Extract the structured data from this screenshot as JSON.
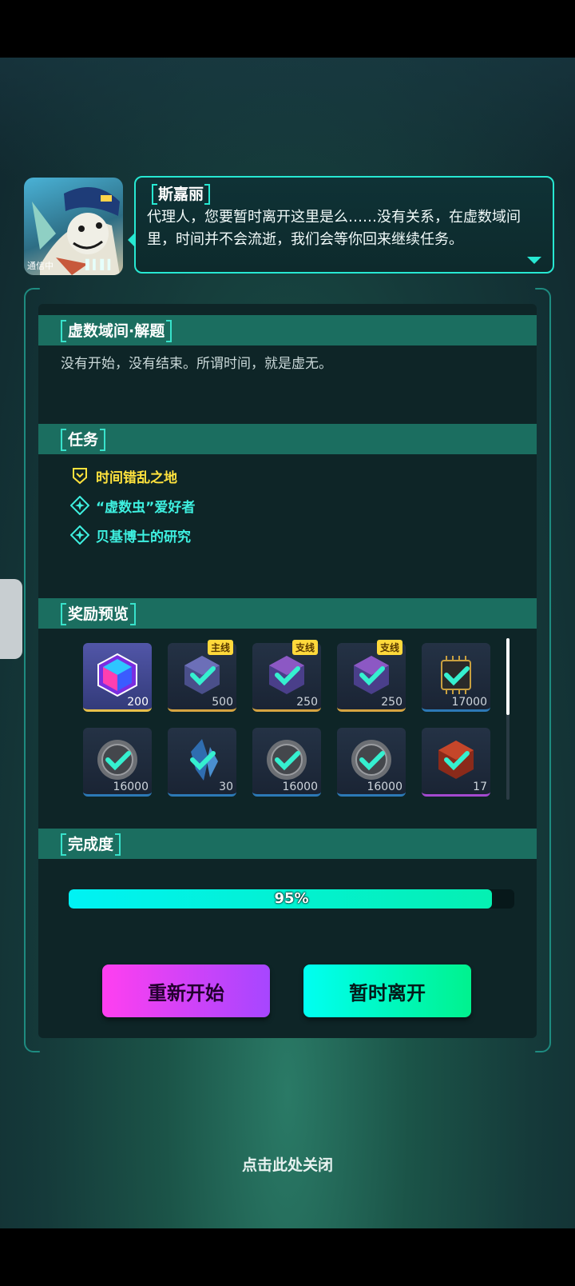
{
  "dialogue": {
    "speaker": "斯嘉丽",
    "text": "代理人，您要暂时离开这里是么……没有关系，在虚数域间里，时间并不会流逝，我们会等你回来继续任务。",
    "portrait_tag": "通信中"
  },
  "sections": {
    "info_title": "虚数域间·解题",
    "info_desc": "没有开始，没有结束。所谓时间，就是虚无。",
    "tasks_title": "任务",
    "rewards_title": "奖励预览",
    "completion_title": "完成度"
  },
  "tasks": [
    {
      "label": "时间错乱之地",
      "type": "main",
      "icon": "shield-quest-icon"
    },
    {
      "label": "“虚数虫”爱好者",
      "type": "side",
      "icon": "diamond-quest-icon"
    },
    {
      "label": "贝基博士的研究",
      "type": "side",
      "icon": "diamond-quest-icon"
    }
  ],
  "rewards": [
    {
      "amount": "200",
      "badge": "",
      "icon": "prism-cube-icon",
      "rarity": "first"
    },
    {
      "amount": "500",
      "badge": "主线",
      "icon": "cube-check-icon",
      "rarity": "gold"
    },
    {
      "amount": "250",
      "badge": "支线",
      "icon": "cube-check-icon",
      "rarity": "gold"
    },
    {
      "amount": "250",
      "badge": "支线",
      "icon": "cube-check-icon",
      "rarity": "gold"
    },
    {
      "amount": "17000",
      "badge": "",
      "icon": "chip-check-icon",
      "rarity": "blue"
    },
    {
      "amount": "16000",
      "badge": "",
      "icon": "coin-check-icon",
      "rarity": "blue"
    },
    {
      "amount": "30",
      "badge": "",
      "icon": "crystal-check-icon",
      "rarity": "blue"
    },
    {
      "amount": "16000",
      "badge": "",
      "icon": "coin-check-icon",
      "rarity": "blue"
    },
    {
      "amount": "16000",
      "badge": "",
      "icon": "coin-check-icon",
      "rarity": "blue"
    },
    {
      "amount": "17",
      "badge": "",
      "icon": "red-cube-check-icon",
      "rarity": "purple"
    }
  ],
  "completion": {
    "value": 0.95,
    "label": "95%"
  },
  "buttons": {
    "restart": "重新开始",
    "leave": "暂时离开"
  },
  "close_hint": "点击此处关闭",
  "colors": {
    "accent": "#27e8d2",
    "main_quest": "#ffe23d",
    "side_quest": "#3ef0e0",
    "section_bar": "#1b6e60"
  }
}
